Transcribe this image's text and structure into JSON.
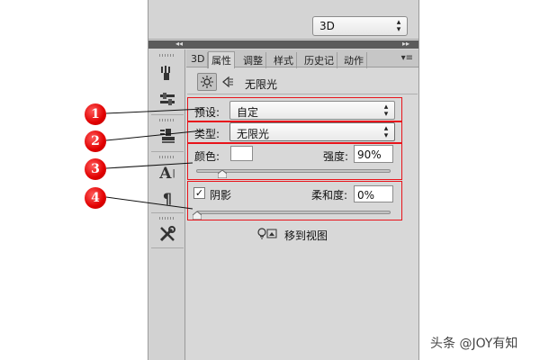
{
  "top": {
    "mode_select": "3D"
  },
  "tabs": [
    "3D",
    "属性",
    "调整",
    "样式",
    "历史记",
    "动作"
  ],
  "panel": {
    "light_type_header": "无限光",
    "preset": {
      "label": "预设:",
      "value": "自定"
    },
    "type": {
      "label": "类型:",
      "value": "无限光"
    },
    "color": {
      "label": "颜色:",
      "swatch_color": "#ffffff"
    },
    "intensity": {
      "label": "强度:",
      "value": "90%",
      "slider_fraction": 0.13
    },
    "shadow": {
      "label": "阴影",
      "checked": true,
      "checkmark": "✓"
    },
    "softness": {
      "label": "柔和度:",
      "value": "0%",
      "slider_fraction": 0.0
    },
    "move_to_view": "移到视图"
  },
  "annotations": [
    "1",
    "2",
    "3",
    "4"
  ],
  "annotation_color": "#e8141b",
  "watermark": "头条 @JOY有知",
  "icons": [
    "sun-light-icon",
    "light-target-icon",
    "brush-tool-icon",
    "adjust-tool-icon",
    "stamp-tool-icon",
    "text-tool-icon",
    "paragraph-icon",
    "tools-icon",
    "move-to-view-icon",
    "collapse-left-icon",
    "collapse-right-icon",
    "panel-menu-icon"
  ]
}
